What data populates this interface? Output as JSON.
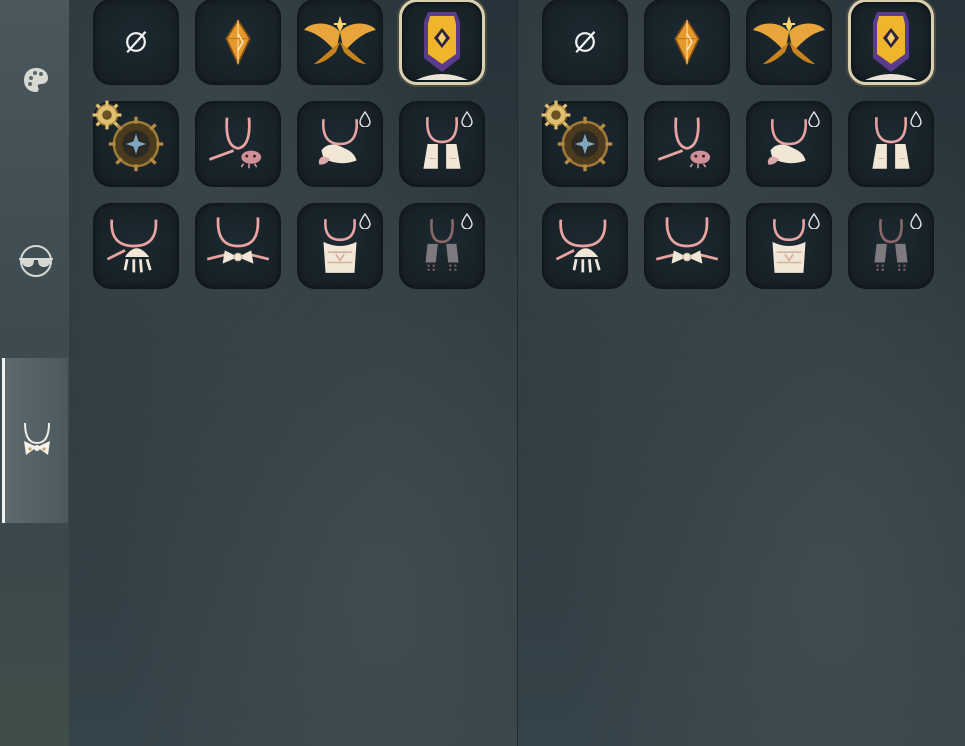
{
  "rail": {
    "items": [
      {
        "name": "hair-category",
        "icon": "palette-icon"
      },
      {
        "name": "glasses-category",
        "icon": "sunglasses-icon"
      },
      {
        "name": "neck-category",
        "icon": "necklace-bow-icon",
        "active": true
      }
    ]
  },
  "panels": [
    {
      "slots": [
        {
          "icon": "none-icon",
          "selected": false,
          "drop": false
        },
        {
          "icon": "amber-crystal-icon",
          "selected": false,
          "drop": false
        },
        {
          "icon": "golden-wings-icon",
          "selected": false,
          "drop": false
        },
        {
          "icon": "purple-amulet-icon",
          "selected": true,
          "drop": false
        },
        {
          "icon": "sun-gear-icon",
          "selected": false,
          "drop": false
        },
        {
          "icon": "necklace-crab-icon",
          "selected": false,
          "drop": false
        },
        {
          "icon": "scarf-fan-icon",
          "selected": false,
          "drop": true
        },
        {
          "icon": "necklace-cloth-icon",
          "selected": false,
          "drop": true
        },
        {
          "icon": "necklace-jellyfish-icon",
          "selected": false,
          "drop": false
        },
        {
          "icon": "necklace-bow-icon",
          "selected": false,
          "drop": false
        },
        {
          "icon": "necklace-scarf-icon",
          "selected": false,
          "drop": true
        },
        {
          "icon": "necklace-tassel-icon",
          "selected": false,
          "drop": true
        }
      ]
    },
    {
      "slots": [
        {
          "icon": "none-icon",
          "selected": false,
          "drop": false
        },
        {
          "icon": "amber-crystal-icon",
          "selected": false,
          "drop": false
        },
        {
          "icon": "golden-wings-icon",
          "selected": false,
          "drop": false
        },
        {
          "icon": "purple-amulet-icon",
          "selected": true,
          "drop": false
        },
        {
          "icon": "sun-gear-icon",
          "selected": false,
          "drop": false
        },
        {
          "icon": "necklace-crab-icon",
          "selected": false,
          "drop": false
        },
        {
          "icon": "scarf-fan-icon",
          "selected": false,
          "drop": true
        },
        {
          "icon": "necklace-cloth-icon",
          "selected": false,
          "drop": true
        },
        {
          "icon": "necklace-jellyfish-icon",
          "selected": false,
          "drop": false
        },
        {
          "icon": "necklace-bow-icon",
          "selected": false,
          "drop": false
        },
        {
          "icon": "necklace-scarf-icon",
          "selected": false,
          "drop": true
        },
        {
          "icon": "necklace-tassel-icon",
          "selected": false,
          "drop": true
        }
      ]
    }
  ],
  "colors": {
    "slot_bg": "#182228",
    "selected_border": "#d9d0b2",
    "cord": "#e9a3a1",
    "gold": "#e8a93a",
    "cream": "#f2e6d6"
  }
}
